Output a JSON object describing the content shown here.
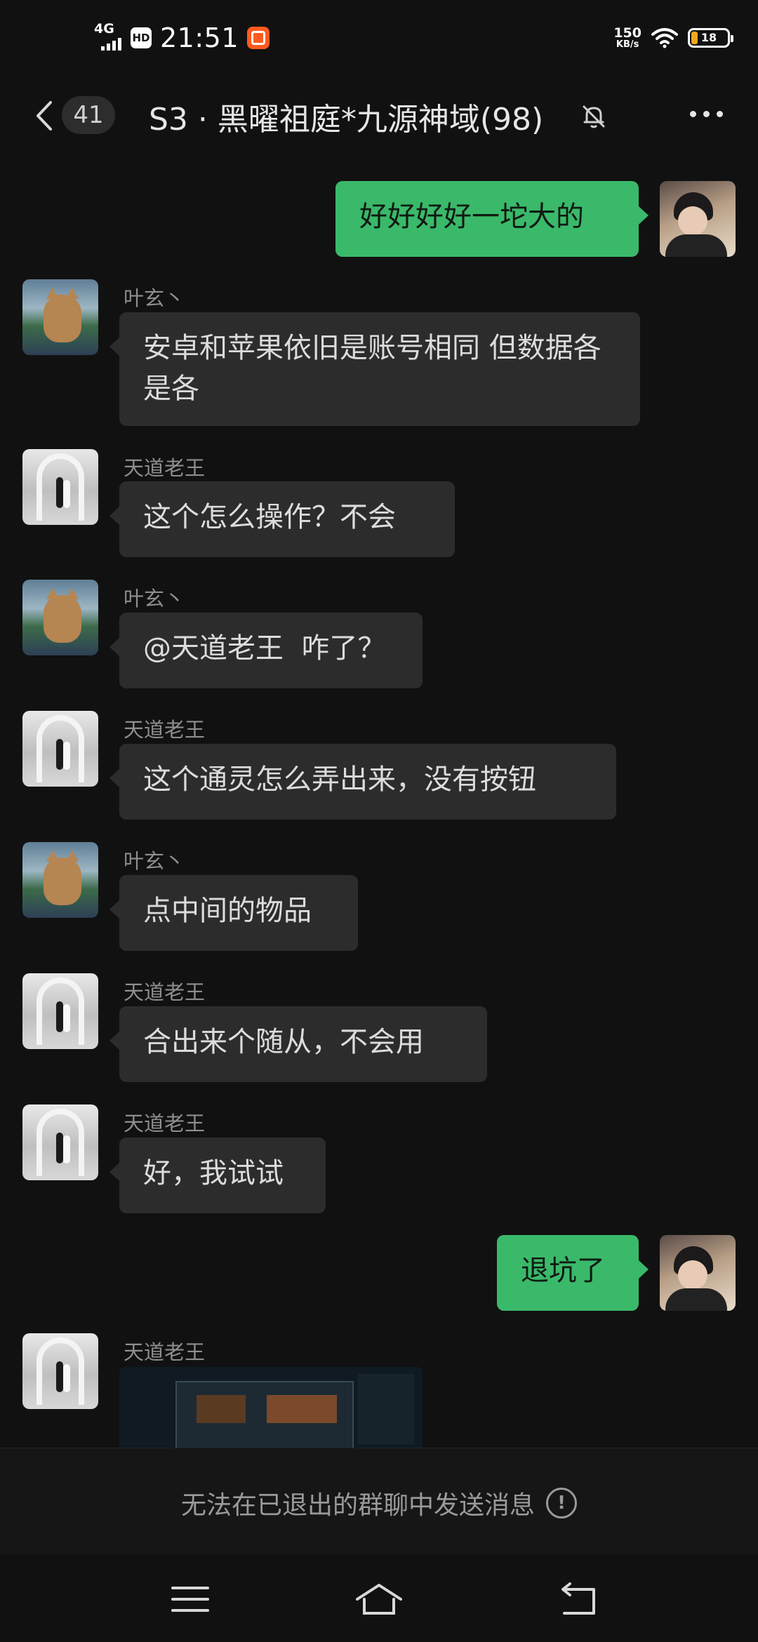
{
  "status_bar": {
    "network": "4G",
    "hd_label": "HD",
    "time": "21:51",
    "speed_value": "150",
    "speed_unit": "KB/s",
    "battery": "18"
  },
  "header": {
    "unread_count": "41",
    "title": "S3 · 黑曜祖庭*九源神域(98)"
  },
  "messages": [
    {
      "direction": "out",
      "text": "好好好好一坨大的"
    },
    {
      "direction": "in",
      "sender": "叶玄丶",
      "text": "安卓和苹果依旧是账号相同 但数据各是各"
    },
    {
      "direction": "in",
      "sender": "天道老王",
      "text": "这个怎么操作？不会"
    },
    {
      "direction": "in",
      "sender": "叶玄丶",
      "text": "@天道老王  咋了？"
    },
    {
      "direction": "in",
      "sender": "天道老王",
      "text": "这个通灵怎么弄出来，没有按钮"
    },
    {
      "direction": "in",
      "sender": "叶玄丶",
      "text": "点中间的物品"
    },
    {
      "direction": "in",
      "sender": "天道老王",
      "text": "合出来个随从，不会用"
    },
    {
      "direction": "in",
      "sender": "天道老王",
      "text": "好，我试试"
    },
    {
      "direction": "out",
      "text": "退坑了"
    },
    {
      "direction": "in",
      "sender": "天道老王",
      "text": ""
    }
  ],
  "footer": {
    "notice": "无法在已退出的群聊中发送消息",
    "info_glyph": "!"
  }
}
